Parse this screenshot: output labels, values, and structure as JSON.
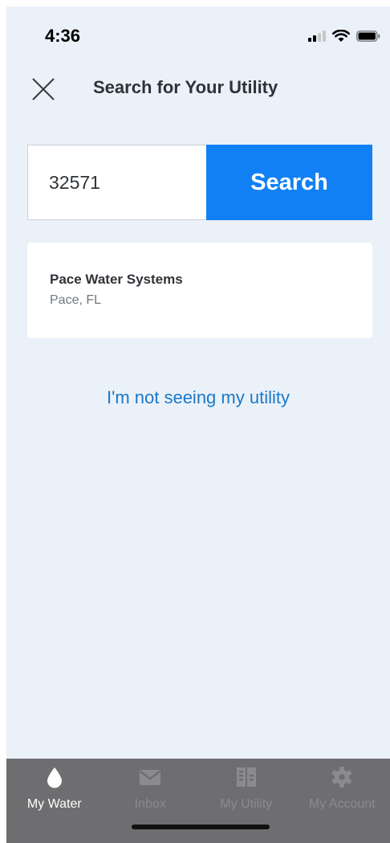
{
  "status_bar": {
    "time": "4:36",
    "icons": [
      "signal-icon",
      "wifi-icon",
      "battery-icon"
    ]
  },
  "header": {
    "title": "Search for Your Utility",
    "close_icon": "close-icon"
  },
  "search": {
    "value": "32571",
    "button_label": "Search"
  },
  "results": [
    {
      "name": "Pace Water Systems",
      "location": "Pace, FL"
    }
  ],
  "not_seeing_link": "I'm not seeing my utility",
  "tab_bar": {
    "active_index": 0,
    "tabs": [
      {
        "label": "My Water",
        "icon": "water-drop-icon"
      },
      {
        "label": "Inbox",
        "icon": "envelope-icon"
      },
      {
        "label": "My Utility",
        "icon": "building-icon"
      },
      {
        "label": "My Account",
        "icon": "gear-icon"
      }
    ]
  },
  "colors": {
    "background": "#ebf1f9",
    "accent": "#1180f5",
    "link": "#1a78c9",
    "tab_bar": "#6e6e70"
  }
}
